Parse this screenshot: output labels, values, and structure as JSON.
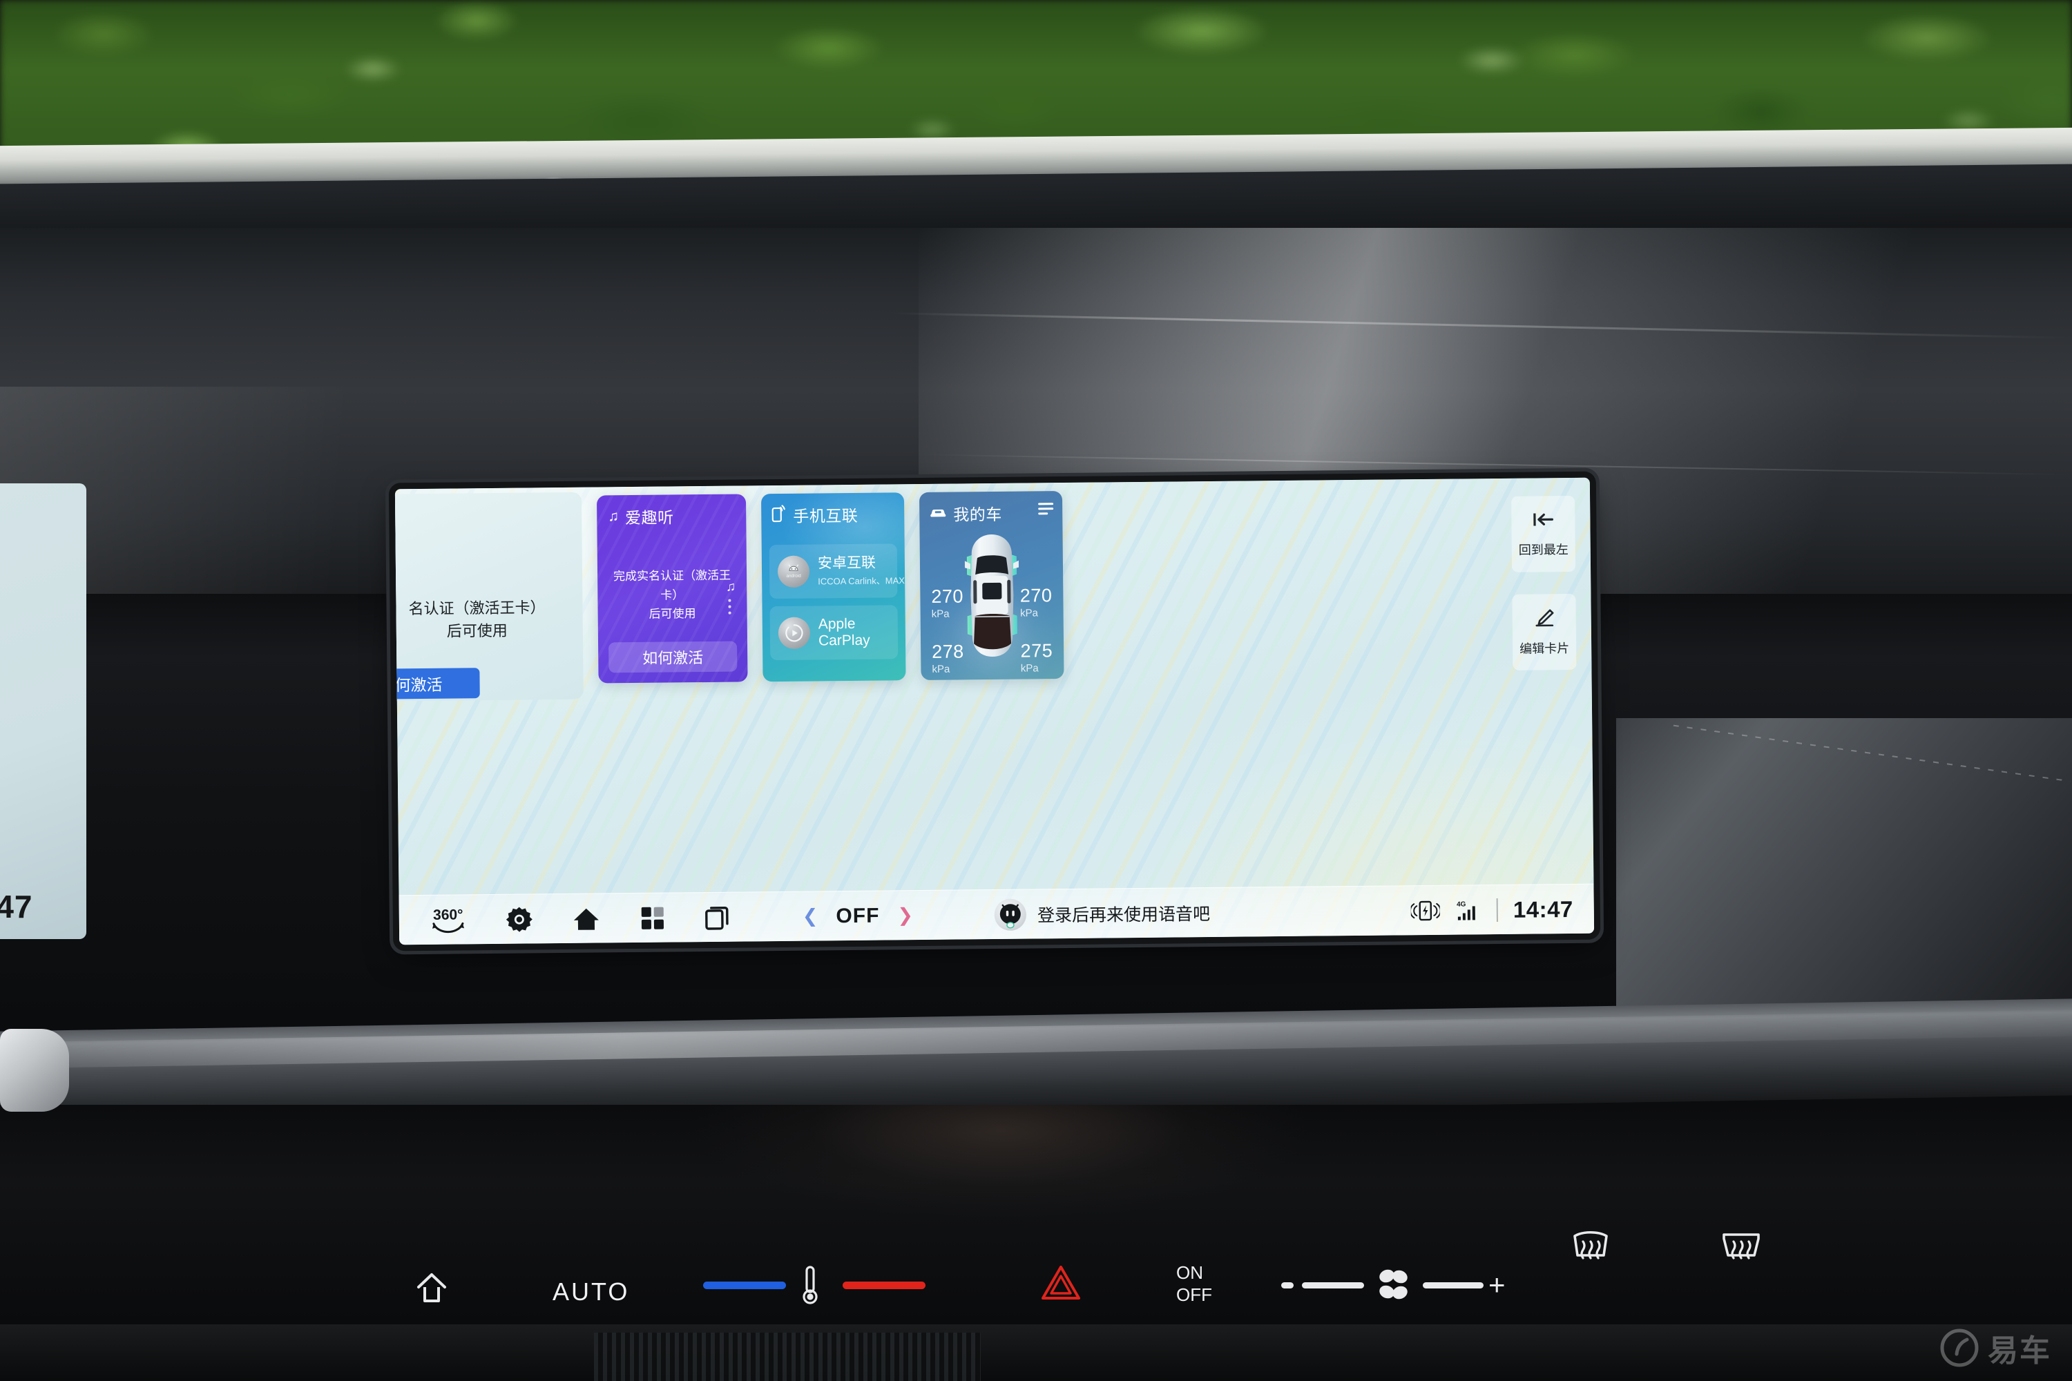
{
  "scene": {
    "description": "Car infotainment center display showing home card screen",
    "watermark": "易车"
  },
  "left_display": {
    "time_partial": ":47"
  },
  "center_display": {
    "cards": [
      {
        "id": "card-left-partial",
        "type": "partial",
        "body_line1": "名认证（激活王卡）",
        "body_line2": "后可使用",
        "button_label": "如何激活",
        "button_color": "#2f6fe0"
      },
      {
        "id": "card-music",
        "type": "music",
        "icon": "music-note-icon",
        "title": "爱趣听",
        "body_line1": "完成实名认证（激活王卡）",
        "body_line2": "后可使用",
        "button_label": "如何激活",
        "accent": "#6a3ce0"
      },
      {
        "id": "card-phone-link",
        "type": "phone-link",
        "icon": "phone-cast-icon",
        "title": "手机互联",
        "items": [
          {
            "icon": "android-icon",
            "label": "安卓互联",
            "sub": "ICCOA Carlink、MAXUS Link"
          },
          {
            "icon": "carplay-icon",
            "label": "Apple CarPlay",
            "sub": ""
          }
        ],
        "accent": "#2f9ad4"
      },
      {
        "id": "card-my-car",
        "type": "my-car",
        "icon": "car-front-icon",
        "title": "我的车",
        "menu_icon": "list-menu-icon",
        "tire_pressure": {
          "unit": "kPa",
          "front_left": "270",
          "front_right": "270",
          "rear_left": "278",
          "rear_right": "275"
        },
        "accent": "#4b86b8"
      }
    ],
    "side_buttons": [
      {
        "icon": "skip-to-start-icon",
        "label": "回到最左"
      },
      {
        "icon": "pencil-edit-icon",
        "label": "编辑卡片"
      }
    ],
    "taskbar": {
      "icons": [
        {
          "name": "surround-view-360-icon",
          "label": "360°"
        },
        {
          "name": "settings-gear-icon",
          "label": ""
        },
        {
          "name": "home-icon",
          "label": ""
        },
        {
          "name": "apps-grid-icon",
          "label": ""
        },
        {
          "name": "recents-icon",
          "label": ""
        }
      ],
      "climate": {
        "prev_icon": "chevron-left-icon",
        "value": "OFF",
        "next_icon": "chevron-right-icon"
      },
      "assistant": {
        "icon": "voice-assistant-icon",
        "hint": "登录后再来使用语音吧"
      },
      "status": {
        "wireless_charge_icon": "wireless-charging-icon",
        "network_label": "4G",
        "signal_icon": "signal-bars-icon",
        "time": "14:47"
      }
    }
  },
  "hvac_panel": {
    "home_icon": "home-outline-icon",
    "auto_label": "AUTO",
    "cool_bar": "#1f5fe0",
    "thermometer_icon": "thermometer-icon",
    "heat_bar": "#e0241c",
    "hazard_icon": "hazard-triangle-icon",
    "hazard_color": "#e0241c",
    "on_label": "ON",
    "off_label": "OFF",
    "fan_minus": "−",
    "fan_icon": "fan-icon",
    "fan_plus": "+",
    "front_defrost_icon": "front-defrost-icon",
    "rear_defrost_icon": "rear-defrost-icon"
  }
}
